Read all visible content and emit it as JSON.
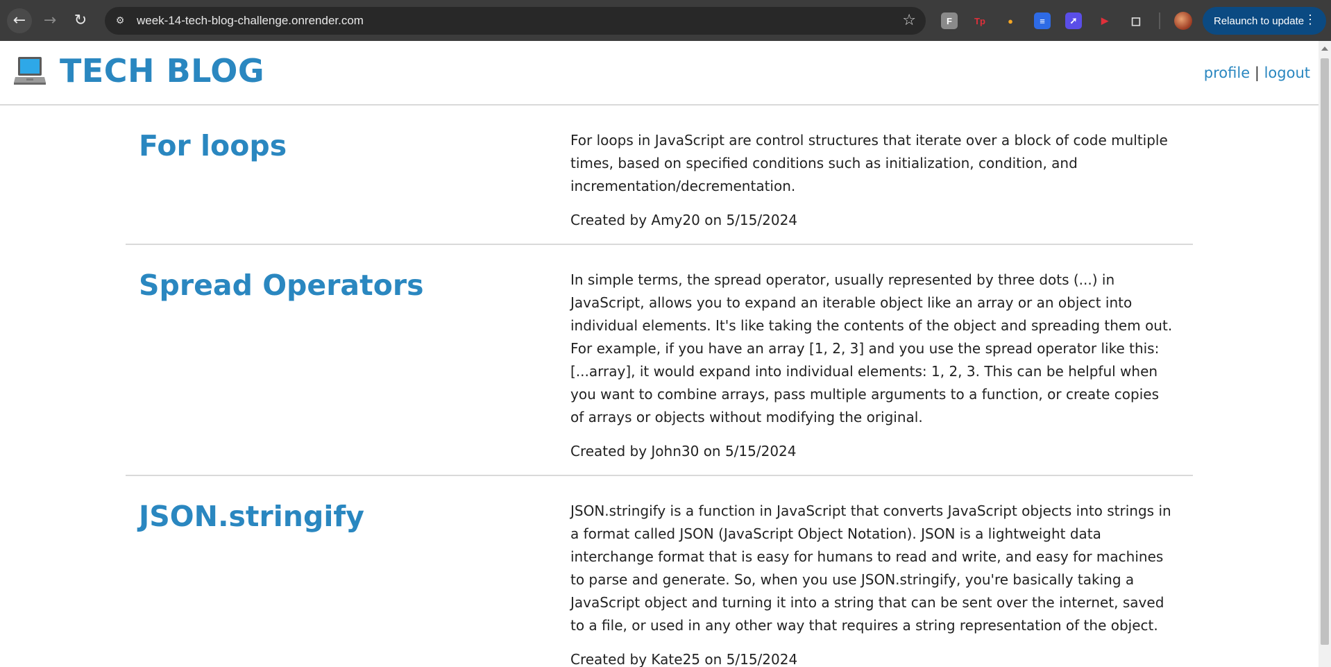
{
  "browser": {
    "url": "week-14-tech-blog-challenge.onrender.com",
    "relaunch_label": "Relaunch to update",
    "extensions": [
      {
        "name": "fj-extension-icon",
        "label": "F",
        "color": "#8a8a8a"
      },
      {
        "name": "tp-extension-icon",
        "label": "Tp",
        "color": "#e0303a"
      },
      {
        "name": "flame-extension-icon",
        "label": "●",
        "color": "#f5a623"
      },
      {
        "name": "doc-extension-icon",
        "label": "≡",
        "color": "#2e6be6"
      },
      {
        "name": "rocket-extension-icon",
        "label": "➚",
        "color": "#5a4ee8"
      },
      {
        "name": "video-extension-icon",
        "label": "▶",
        "color": "#e0303a"
      }
    ]
  },
  "header": {
    "title": "TECH BLOG",
    "nav": {
      "profile": "profile",
      "separator": "|",
      "logout": "logout"
    }
  },
  "posts": [
    {
      "title": "For loops",
      "content": "For loops in JavaScript are control structures that iterate over a block of code multiple times, based on specified conditions such as initialization, condition, and incrementation/decrementation.",
      "meta": "Created by Amy20 on 5/15/2024"
    },
    {
      "title": "Spread Operators",
      "content": "In simple terms, the spread operator, usually represented by three dots (...) in JavaScript, allows you to expand an iterable object like an array or an object into individual elements. It's like taking the contents of the object and spreading them out. For example, if you have an array [1, 2, 3] and you use the spread operator like this: [...array], it would expand into individual elements: 1, 2, 3. This can be helpful when you want to combine arrays, pass multiple arguments to a function, or create copies of arrays or objects without modifying the original.",
      "meta": "Created by John30 on 5/15/2024"
    },
    {
      "title": "JSON.stringify",
      "content": "JSON.stringify is a function in JavaScript that converts JavaScript objects into strings in a format called JSON (JavaScript Object Notation). JSON is a lightweight data interchange format that is easy for humans to read and write, and easy for machines to parse and generate. So, when you use JSON.stringify, you're basically taking a JavaScript object and turning it into a string that can be sent over the internet, saved to a file, or used in any other way that requires a string representation of the object.",
      "meta": "Created by Kate25 on 5/15/2024"
    }
  ]
}
